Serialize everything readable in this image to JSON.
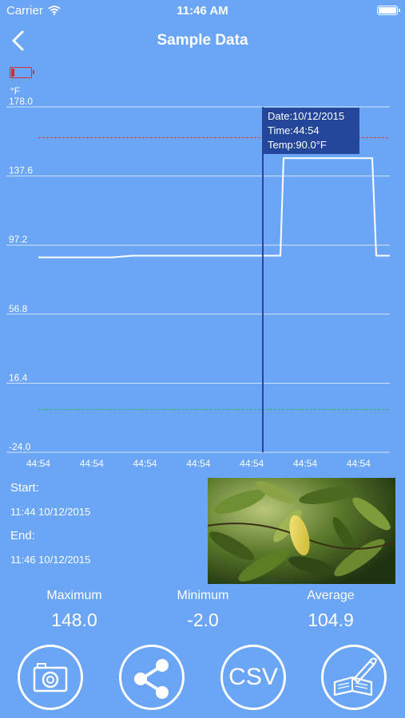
{
  "status_bar": {
    "carrier": "Carrier",
    "time": "11:46 AM"
  },
  "nav": {
    "title": "Sample Data"
  },
  "unit": "°F",
  "tooltip": {
    "date": "Date:10/12/2015",
    "time": "Time:44:54",
    "temp": "Temp:90.0°F"
  },
  "chart_data": {
    "type": "line",
    "ylim": [
      -24.0,
      178.0
    ],
    "y_ticks": [
      "178.0",
      "137.6",
      "97.2",
      "56.8",
      "16.4",
      "-24.0"
    ],
    "x_ticks": [
      "44:54",
      "44:54",
      "44:54",
      "44:54",
      "44:54",
      "44:54",
      "44:54"
    ],
    "series": [
      {
        "values": [
          90.0,
          90.0,
          90.0,
          90.0,
          91.0,
          91.0,
          91.0,
          91.0,
          91.0,
          91.0,
          91.0,
          91.0,
          91.0,
          91.0,
          148.0,
          148.0,
          148.0,
          148.0,
          148.0,
          91.0,
          91.0
        ]
      }
    ],
    "high_alarm": 160.0,
    "low_alarm": 1.0,
    "cursor_value": 90.0,
    "colors": {
      "line": "#ffffff",
      "high_alarm": "#e03a3a",
      "low_alarm": "#2fb85a",
      "cursor": "#24469a",
      "grid": "#ffffff"
    }
  },
  "info": {
    "start_label": "Start:",
    "start_value": "11:44 10/12/2015",
    "end_label": "End:",
    "end_value": "11:46 10/12/2015"
  },
  "stats": {
    "max_label": "Maximum",
    "max_value": "148.0",
    "min_label": "Minimum",
    "min_value": "-2.0",
    "avg_label": "Average",
    "avg_value": "104.9"
  },
  "actions": {
    "camera_icon": "camera-icon",
    "share_icon": "share-icon",
    "csv_label": "CSV",
    "notes_icon": "notebook-pen-icon"
  }
}
